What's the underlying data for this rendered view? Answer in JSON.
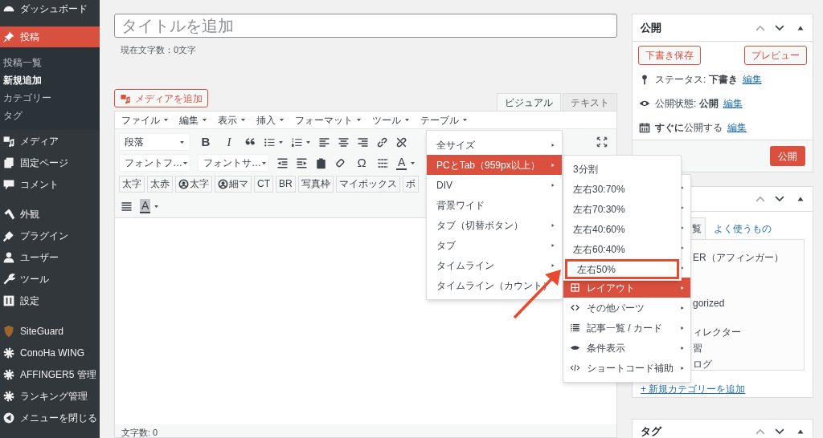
{
  "sidebar": {
    "items": [
      {
        "label": "ダッシュボード",
        "selected": false
      },
      {
        "label": "投稿",
        "selected": true,
        "children": [
          {
            "label": "投稿一覧",
            "selected": false
          },
          {
            "label": "新規追加",
            "selected": true
          },
          {
            "label": "カテゴリー",
            "selected": false
          },
          {
            "label": "タグ",
            "selected": false
          }
        ]
      },
      {
        "label": "メディア",
        "selected": false
      },
      {
        "label": "固定ページ",
        "selected": false
      },
      {
        "label": "コメント",
        "selected": false
      },
      {
        "label": "外観",
        "selected": false
      },
      {
        "label": "プラグイン",
        "selected": false
      },
      {
        "label": "ユーザー",
        "selected": false
      },
      {
        "label": "ツール",
        "selected": false
      },
      {
        "label": "設定",
        "selected": false
      },
      {
        "label": "SiteGuard",
        "selected": false
      },
      {
        "label": "ConoHa WING",
        "selected": false
      },
      {
        "label": "AFFINGER5 管理",
        "selected": false
      },
      {
        "label": "ランキング管理",
        "selected": false
      },
      {
        "label": "メニューを閉じる",
        "selected": false
      }
    ]
  },
  "editor": {
    "title_field": {
      "placeholder": "タイトルを追加"
    },
    "char_count": "現在文字数：0文字",
    "add_media": "メディアを追加",
    "tabs": [
      {
        "label": "ビジュアル",
        "selected": true
      },
      {
        "label": "テキスト",
        "selected": false
      }
    ],
    "menubar": [
      "ファイル",
      "編集",
      "表示",
      "挿入",
      "フォーマット",
      "ツール",
      "テーブル"
    ],
    "toolbar_1": [
      {
        "kind": "select",
        "text": "段落"
      },
      {
        "kind": "bold",
        "text": "B"
      },
      {
        "kind": "italic",
        "text": "I"
      },
      {
        "kind": "quote"
      },
      {
        "kind": "bullets"
      },
      {
        "kind": "numbers"
      },
      {
        "kind": "align_left"
      },
      {
        "kind": "align_center"
      },
      {
        "kind": "align_right"
      },
      {
        "kind": "link"
      },
      {
        "kind": "unlink"
      }
    ],
    "toolbar_2": [
      {
        "kind": "select",
        "text": "フォントフ…"
      },
      {
        "kind": "select",
        "text": "フォントサ…"
      },
      {
        "kind": "outdent"
      },
      {
        "kind": "indent"
      },
      {
        "kind": "paste"
      },
      {
        "kind": "eraser"
      },
      {
        "kind": "glyph",
        "text": "Ω"
      },
      {
        "kind": "rule"
      },
      {
        "kind": "color",
        "text": "A"
      }
    ],
    "quicktags": [
      {
        "kind": "text",
        "label": "太字"
      },
      {
        "kind": "text",
        "label": "太赤"
      },
      {
        "kind": "user",
        "label": "太字"
      },
      {
        "kind": "user",
        "label": "細マ"
      },
      {
        "kind": "text",
        "label": "CT"
      },
      {
        "kind": "text",
        "label": "BR"
      },
      {
        "kind": "text",
        "label": "写真枠"
      },
      {
        "kind": "text",
        "label": "マイボックス"
      },
      {
        "kind": "text",
        "label": "ボ"
      }
    ],
    "toolbar_4": [
      {
        "kind": "justify"
      },
      {
        "kind": "highlight",
        "text": "A"
      }
    ],
    "word_count": "文字数: 0"
  },
  "dropdown": {
    "menu": [
      {
        "label": "全サイズ",
        "selected": false,
        "submenu": true
      },
      {
        "label": "PCとTab（959px以上）",
        "selected": true,
        "submenu": true
      },
      {
        "label": "DIV",
        "selected": false,
        "submenu": true
      },
      {
        "label": "背景ワイド",
        "selected": false,
        "submenu": false
      },
      {
        "label": "タブ（切替ボタン）",
        "selected": false,
        "submenu": true
      },
      {
        "label": "タブ",
        "selected": false,
        "submenu": true
      },
      {
        "label": "タイムライン",
        "selected": false,
        "submenu": true
      },
      {
        "label": "タイムライン（カウント）",
        "selected": false,
        "submenu": false
      }
    ],
    "submenu": [
      {
        "label": "3分割",
        "marked": false
      },
      {
        "label": "左右30:70%",
        "marked": false
      },
      {
        "label": "左右70:30%",
        "marked": false
      },
      {
        "label": "左右40:60%",
        "marked": false
      },
      {
        "label": "左右60:40%",
        "marked": false
      },
      {
        "label": "左右50%",
        "marked": true
      }
    ],
    "parent_menu": [
      {
        "label": "レイアウト",
        "selected": true
      },
      {
        "label": "その他パーツ",
        "selected": false
      },
      {
        "label": "記事一覧 / カード",
        "selected": false
      },
      {
        "label": "条件表示",
        "selected": false
      },
      {
        "label": "ショートコード補助",
        "selected": false
      }
    ]
  },
  "publish": {
    "title": "公開",
    "save_draft": "下書き保存",
    "preview": "プレビュー",
    "rows": [
      {
        "text": "ステータス: **下書き**",
        "link": "編集"
      },
      {
        "text": "公開状態: **公開**",
        "link": "編集"
      },
      {
        "text": "**すぐに**公開する",
        "link": "編集"
      }
    ],
    "publish_button": "公開"
  },
  "categories": {
    "tabs": [
      {
        "label": "覧",
        "selected": true
      },
      {
        "label": "よく使うもの",
        "selected": false
      }
    ],
    "items": [
      "ER（アフィンガー）",
      "gorized",
      "ィレクター",
      "習",
      "ログ"
    ],
    "add_link": "+ 新規カテゴリーを追加"
  },
  "tags": {
    "title": "タグ"
  }
}
